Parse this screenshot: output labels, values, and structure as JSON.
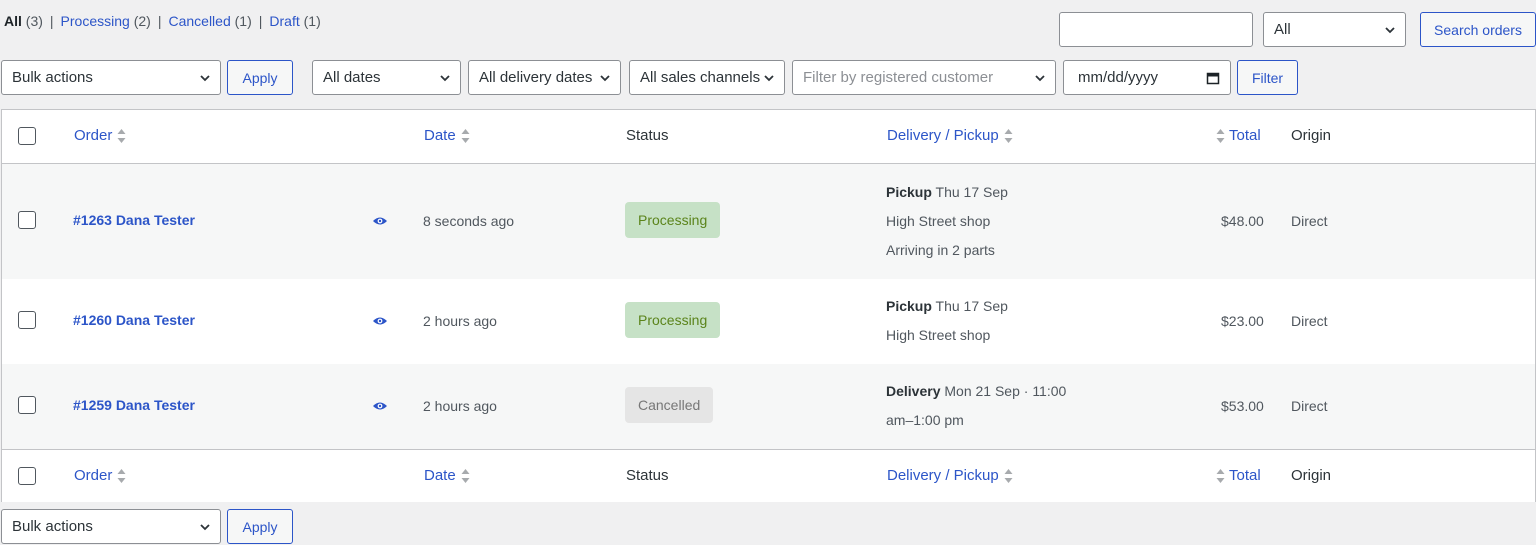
{
  "views": [
    {
      "label": "All",
      "count": "(3)",
      "current": true
    },
    {
      "label": "Processing",
      "count": "(2)",
      "current": false
    },
    {
      "label": "Cancelled",
      "count": "(1)",
      "current": false
    },
    {
      "label": "Draft",
      "count": "(1)",
      "current": false
    }
  ],
  "search": {
    "value": "",
    "status_select": "All",
    "button": "Search orders"
  },
  "filters": {
    "bulk_actions": "Bulk actions",
    "apply": "Apply",
    "dates": "All dates",
    "delivery_dates": "All delivery dates",
    "sales_channels": "All sales channels",
    "customer_placeholder": "Filter by registered customer",
    "date_placeholder": "mm/dd/yyyy",
    "filter_button": "Filter"
  },
  "columns": {
    "order": "Order",
    "date": "Date",
    "status": "Status",
    "delivery": "Delivery / Pickup",
    "total": "Total",
    "origin": "Origin"
  },
  "orders": [
    {
      "title": "#1263 Dana Tester",
      "date": "8 seconds ago",
      "status": "Processing",
      "delivery_type": "Pickup",
      "delivery_date": "Thu 17 Sep",
      "delivery_line2": "High Street shop",
      "delivery_line3": "Arriving in 2 parts",
      "total": "$48.00",
      "origin": "Direct"
    },
    {
      "title": "#1260 Dana Tester",
      "date": "2 hours ago",
      "status": "Processing",
      "delivery_type": "Pickup",
      "delivery_date": "Thu 17 Sep",
      "delivery_line2": "High Street shop",
      "total": "$23.00",
      "origin": "Direct"
    },
    {
      "title": "#1259 Dana Tester",
      "date": "2 hours ago",
      "status": "Cancelled",
      "delivery_type": "Delivery",
      "delivery_date": "Mon 21 Sep · 11:00",
      "delivery_line2": "am–1:00 pm",
      "total": "$53.00",
      "origin": "Direct"
    }
  ],
  "bottom": {
    "bulk_actions": "Bulk actions",
    "apply": "Apply"
  },
  "colors": {
    "accent": "#2c55c8",
    "processing_bg": "#c6e1c6",
    "processing_text": "#5b841b",
    "cancelled_bg": "#e5e5e5"
  },
  "icons": [
    "chevron-down-icon",
    "sort-arrows-icon",
    "eye-icon",
    "calendar-icon",
    "checkbox-icon"
  ]
}
